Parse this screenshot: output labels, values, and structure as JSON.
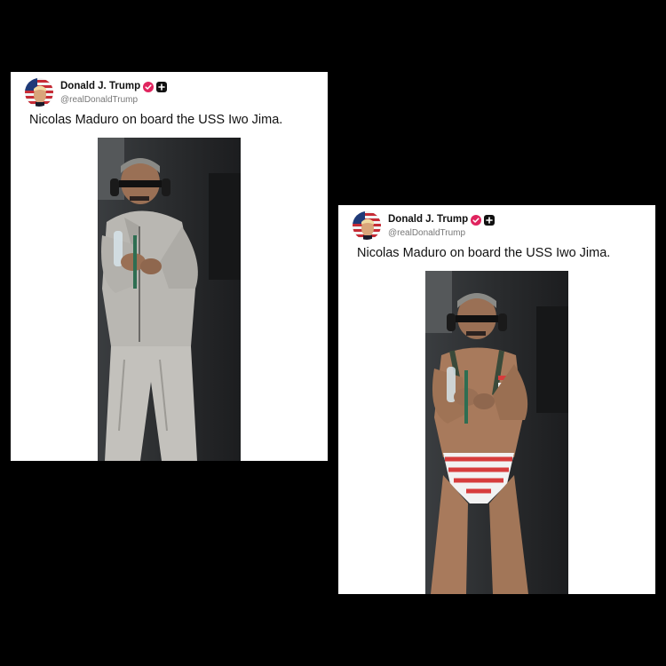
{
  "posts": [
    {
      "author": {
        "display_name": "Donald J. Trump",
        "handle": "@realDonaldTrump",
        "verified_badge_icon": "verified-badge-icon",
        "badge_color": "#e0245e",
        "extra_badge_icon": "plus-square-icon"
      },
      "text": "Nicolas Maduro on board the USS Iwo Jima.",
      "photo": {
        "description_icon": "photo",
        "variant": "gray tracksuit"
      }
    },
    {
      "author": {
        "display_name": "Donald J. Trump",
        "handle": "@realDonaldTrump",
        "verified_badge_icon": "verified-badge-icon",
        "badge_color": "#e0245e",
        "extra_badge_icon": "plus-square-icon"
      },
      "text": "Nicolas Maduro on board the USS Iwo Jima.",
      "photo": {
        "description_icon": "photo",
        "variant": "striped swimwear"
      }
    }
  ],
  "colors": {
    "background": "#000000",
    "card": "#ffffff",
    "text": "#111111",
    "handle": "#777777"
  }
}
